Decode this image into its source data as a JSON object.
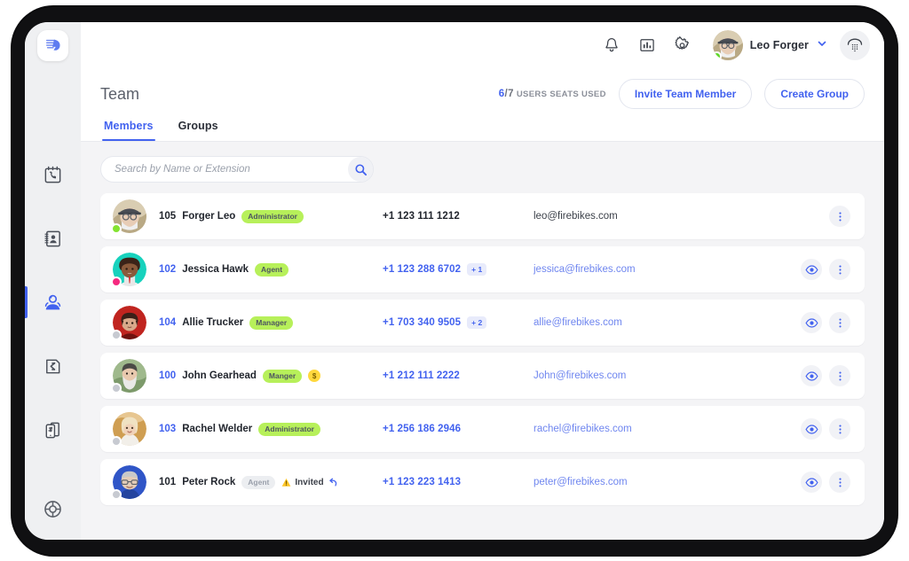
{
  "app": {
    "logo_icon": "brand-logo-icon"
  },
  "topnav": {
    "bell_icon": "bell-icon",
    "analytics_icon": "chart-bar-icon",
    "settings_icon": "gear-icon",
    "user_name": "Leo Forger",
    "chevron_icon": "chevron-down-icon",
    "dialpad_icon": "dialpad-phone-icon",
    "status_color": "#5fd92a"
  },
  "sidebar": {
    "items": [
      {
        "name": "call-log",
        "icon": "calendar-phone-icon",
        "active": false
      },
      {
        "name": "contacts",
        "icon": "address-book-icon",
        "active": false
      },
      {
        "name": "team",
        "icon": "team-person-icon",
        "active": true
      },
      {
        "name": "call-flow",
        "icon": "call-routing-icon",
        "active": false
      },
      {
        "name": "phone-numbers",
        "icon": "hash-phone-icon",
        "active": false
      }
    ],
    "help_icon": "lifebuoy-help-icon"
  },
  "page": {
    "title": "Team",
    "seats": {
      "used": "6",
      "separator": "/",
      "total": "7",
      "label": "USERS SEATS USED"
    },
    "invite_button": "Invite Team Member",
    "create_group_button": "Create Group",
    "tabs": [
      {
        "label": "Members",
        "active": true
      },
      {
        "label": "Groups",
        "active": false
      }
    ]
  },
  "search": {
    "value": "",
    "placeholder": "Search by Name or Extension",
    "icon": "search-icon"
  },
  "members": [
    {
      "extension": "105",
      "name": "Forger Leo",
      "role": "Administrator",
      "role_style": "green",
      "phone": "+1 123 111 1212",
      "extra_numbers": "",
      "email": "leo@firebikes.com",
      "status_color": "#84e331",
      "self": true,
      "invited": false,
      "billing": false,
      "has_view": false,
      "avatar_colors": [
        "#d8cbb0",
        "#8a7f6b"
      ]
    },
    {
      "extension": "102",
      "name": "Jessica Hawk",
      "role": "Agent",
      "role_style": "green",
      "phone": "+1 123 288 6702",
      "extra_numbers": "+ 1",
      "email": "jessica@firebikes.com",
      "status_color": "#f5297f",
      "self": false,
      "invited": false,
      "billing": false,
      "has_view": true,
      "avatar_colors": [
        "#17d2bd",
        "#6d3b22"
      ]
    },
    {
      "extension": "104",
      "name": "Allie Trucker",
      "role": "Manager",
      "role_style": "green",
      "phone": "+1 703 340 9505",
      "extra_numbers": "+ 2",
      "email": "allie@firebikes.com",
      "status_color": "#c7cad1",
      "self": false,
      "invited": false,
      "billing": false,
      "has_view": true,
      "avatar_colors": [
        "#c0241f",
        "#3c2420"
      ]
    },
    {
      "extension": "100",
      "name": "John Gearhead",
      "role": "Manger",
      "role_style": "green",
      "phone": "+1 212 111 2222",
      "extra_numbers": "",
      "email": "John@firebikes.com",
      "status_color": "#c7cad1",
      "self": false,
      "invited": false,
      "billing": true,
      "billing_symbol": "$",
      "has_view": true,
      "avatar_colors": [
        "#9fb98c",
        "#4a4a46"
      ]
    },
    {
      "extension": "103",
      "name": "Rachel Welder",
      "role": "Administrator",
      "role_style": "green",
      "phone": "+1 256 186 2946",
      "extra_numbers": "",
      "email": "rachel@firebikes.com",
      "status_color": "#c7cad1",
      "self": false,
      "invited": false,
      "billing": false,
      "has_view": true,
      "avatar_colors": [
        "#d8a24c",
        "#f2e3c8"
      ]
    },
    {
      "extension": "101",
      "name": "Peter Rock",
      "role": "Agent",
      "role_style": "gray",
      "phone": "+1 123 223 1413",
      "extra_numbers": "",
      "email": "peter@firebikes.com",
      "status_color": "#c7cad1",
      "self": true,
      "invited": true,
      "invited_label": "Invited",
      "invited_icon": "warning-triangle-icon",
      "resend_icon": "resend-arrow-icon",
      "billing": false,
      "has_view": true,
      "avatar_colors": [
        "#2f55c7",
        "#e4cdb8"
      ]
    }
  ],
  "row_actions": {
    "view_icon": "eye-icon",
    "menu_icon": "more-vertical-icon"
  },
  "colors": {
    "accent": "#4262ef",
    "badge_green": "#b7f05a",
    "badge_yellow": "#ffd83d",
    "online": "#5fd92a"
  }
}
